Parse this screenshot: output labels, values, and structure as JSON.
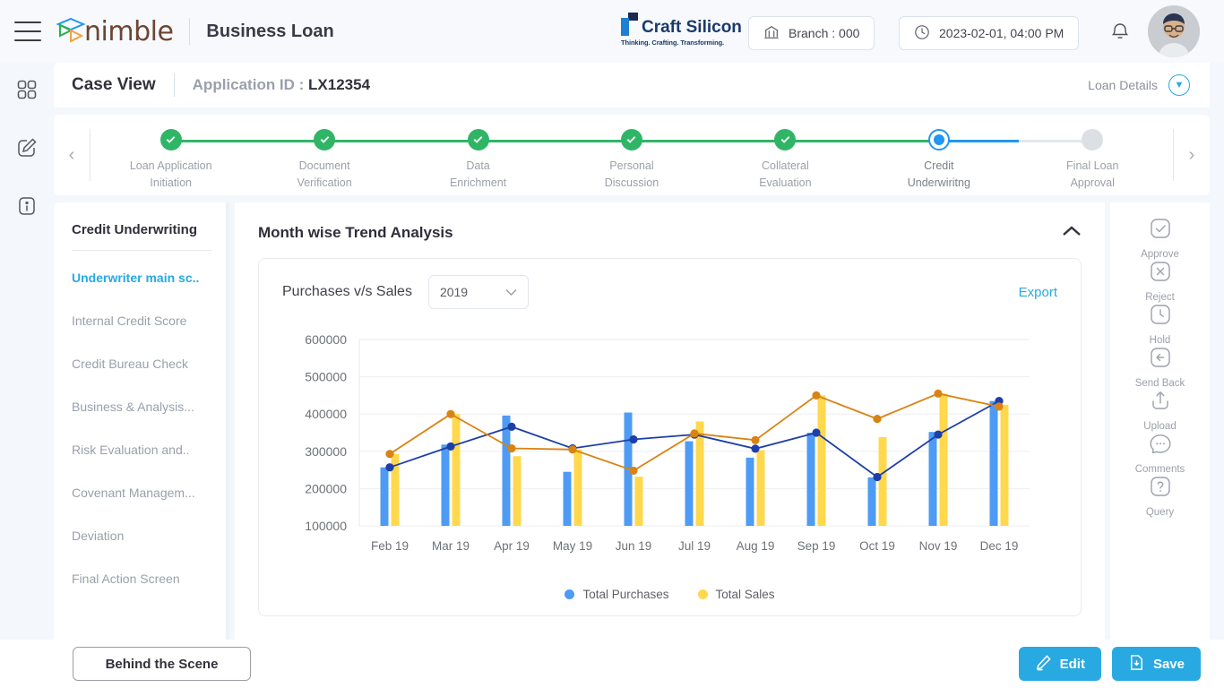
{
  "header": {
    "menu_icon": "hamburger-icon",
    "brand": "nimble",
    "app_title": "Business Loan",
    "company_name": "Craft Silicon",
    "company_tagline": "Thinking. Crafting. Transforming.",
    "branch": "Branch : 000",
    "datetime": "2023-02-01, 04:00 PM",
    "bell_icon": "notification-bell-icon",
    "avatar_icon": "user-avatar"
  },
  "caseview": {
    "title": "Case View",
    "application_label": "Application ID",
    "application_id": "LX12354",
    "loan_details": "Loan Details"
  },
  "stepper": {
    "prev": "‹",
    "next": "›",
    "steps": [
      {
        "line1": "Loan Application",
        "line2": "Initiation",
        "state": "done"
      },
      {
        "line1": "Document",
        "line2": "Verification",
        "state": "done"
      },
      {
        "line1": "Data",
        "line2": "Enrichment",
        "state": "done"
      },
      {
        "line1": "Personal",
        "line2": "Discussion",
        "state": "done"
      },
      {
        "line1": "Collateral",
        "line2": "Evaluation",
        "state": "done"
      },
      {
        "line1": "Credit",
        "line2": "Underwiritng",
        "state": "current"
      },
      {
        "line1": "Final Loan",
        "line2": "Approval",
        "state": "pending"
      }
    ]
  },
  "rail_left": [
    {
      "icon": "dashboard-grid-icon"
    },
    {
      "icon": "edit-pencil-icon"
    },
    {
      "icon": "info-icon"
    }
  ],
  "left_panel": {
    "title": "Credit Underwriting",
    "items": [
      {
        "label": "Underwriter main sc..",
        "active": true
      },
      {
        "label": "Internal Credit Score",
        "active": false
      },
      {
        "label": "Credit Bureau Check",
        "active": false
      },
      {
        "label": "Business & Analysis...",
        "active": false
      },
      {
        "label": "Risk Evaluation and..",
        "active": false
      },
      {
        "label": "Covenant Managem...",
        "active": false
      },
      {
        "label": "Deviation",
        "active": false
      },
      {
        "label": "Final Action Screen",
        "active": false
      }
    ]
  },
  "main": {
    "section_title": "Month wise Trend Analysis",
    "collapse_icon": "chevron-up-icon",
    "chart_title": "Purchases v/s Sales",
    "year_selected": "2019",
    "export_label": "Export"
  },
  "rail_right": [
    {
      "label": "Approve",
      "icon": "check-square-icon"
    },
    {
      "label": "Reject",
      "icon": "x-square-icon"
    },
    {
      "label": "Hold",
      "icon": "clock-square-icon"
    },
    {
      "label": "Send Back",
      "icon": "arrow-left-square-icon"
    },
    {
      "label": "Upload",
      "icon": "upload-icon"
    },
    {
      "label": "Comments",
      "icon": "comment-bubble-icon"
    },
    {
      "label": "Query",
      "icon": "question-square-icon"
    }
  ],
  "footer": {
    "behind_scene": "Behind the Scene",
    "edit": "Edit",
    "save": "Save",
    "edit_icon": "pencil-icon",
    "save_icon": "save-file-icon"
  },
  "colors": {
    "accent": "#29a9e1",
    "success": "#30b566",
    "bar_purchases": "#4d9bf5",
    "bar_sales": "#ffd84d",
    "line_purchases": "#1f3fa8",
    "line_sales": "#d98313"
  },
  "chart_data": {
    "type": "bar",
    "title": "Purchases v/s Sales",
    "xlabel": "",
    "ylabel": "",
    "ylim": [
      100000,
      600000
    ],
    "yticks": [
      100000,
      200000,
      300000,
      400000,
      500000,
      600000
    ],
    "grid": true,
    "legend_position": "bottom",
    "categories": [
      "Feb 19",
      "Mar 19",
      "Apr 19",
      "May 19",
      "Jun 19",
      "Jul 19",
      "Aug 19",
      "Sep 19",
      "Oct 19",
      "Nov 19",
      "Dec 19"
    ],
    "series": [
      {
        "name": "Total Purchases",
        "type": "bar+line",
        "color": "#4d9bf5",
        "values": [
          257000,
          318000,
          396000,
          245000,
          404000,
          327000,
          283000,
          350000,
          230000,
          352000,
          435000
        ]
      },
      {
        "name": "Total Sales",
        "type": "bar+line",
        "color": "#ffd84d",
        "values": [
          293000,
          400000,
          287000,
          305000,
          232000,
          380000,
          303000,
          450000,
          338000,
          455000,
          425000
        ]
      }
    ],
    "overlay_lines": [
      {
        "name": "Total Purchases trend",
        "color": "#1f3fa8",
        "values": [
          257000,
          313000,
          366000,
          308000,
          332000,
          345000,
          307000,
          350000,
          231000,
          345000,
          435000
        ]
      },
      {
        "name": "Total Sales trend",
        "color": "#d98313",
        "values": [
          293000,
          400000,
          308000,
          305000,
          248000,
          348000,
          330000,
          450000,
          387000,
          455000,
          420000
        ]
      }
    ]
  }
}
